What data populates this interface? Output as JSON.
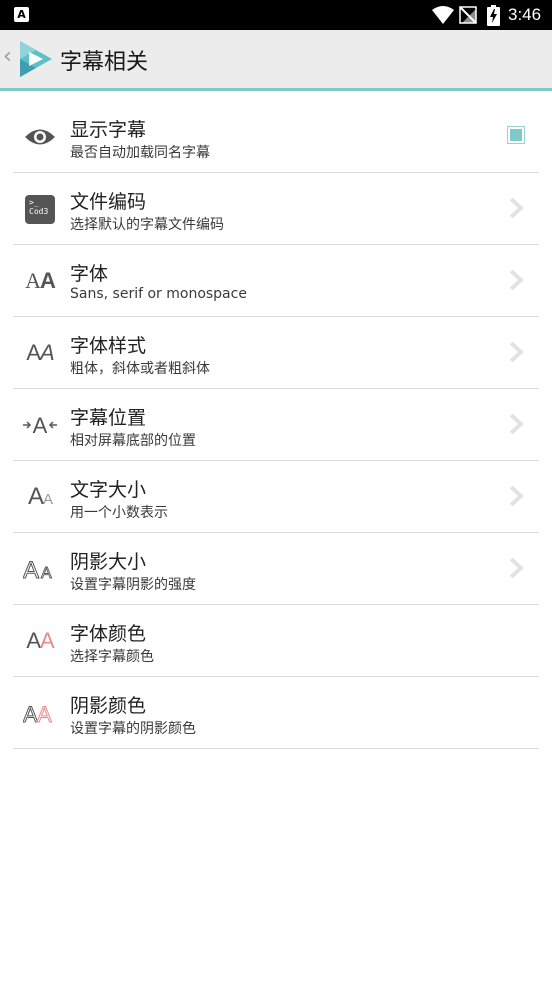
{
  "status_bar": {
    "time": "3:46",
    "notification_icon": "a-icon"
  },
  "header": {
    "title": "字幕相关",
    "back_icon": "chevron-left-icon"
  },
  "accent_color": "#7fc9c9",
  "settings": [
    {
      "title": "显示字幕",
      "subtitle": "最否自动加载同名字幕",
      "icon": "eye-icon",
      "control": "checkbox",
      "checked": true
    },
    {
      "title": "文件编码",
      "subtitle": "选择默认的字幕文件编码",
      "icon": "terminal-icon",
      "icon_text": ">_ Cod3",
      "control": "chevron"
    },
    {
      "title": "字体",
      "subtitle": "Sans, serif or monospace",
      "icon": "font-family-icon",
      "control": "chevron"
    },
    {
      "title": "字体样式",
      "subtitle": "粗体，斜体或者粗斜体",
      "icon": "font-style-icon",
      "control": "chevron"
    },
    {
      "title": "字幕位置",
      "subtitle": "相对屏幕底部的位置",
      "icon": "subtitle-position-icon",
      "control": "chevron"
    },
    {
      "title": "文字大小",
      "subtitle": "用一个小数表示",
      "icon": "text-size-icon",
      "control": "chevron"
    },
    {
      "title": "阴影大小",
      "subtitle": "设置字幕阴影的强度",
      "icon": "shadow-size-icon",
      "control": "chevron"
    },
    {
      "title": "字体颜色",
      "subtitle": "选择字幕颜色",
      "icon": "font-color-icon",
      "control": "none"
    },
    {
      "title": "阴影颜色",
      "subtitle": "设置字幕的阴影颜色",
      "icon": "shadow-color-icon",
      "control": "none"
    }
  ]
}
